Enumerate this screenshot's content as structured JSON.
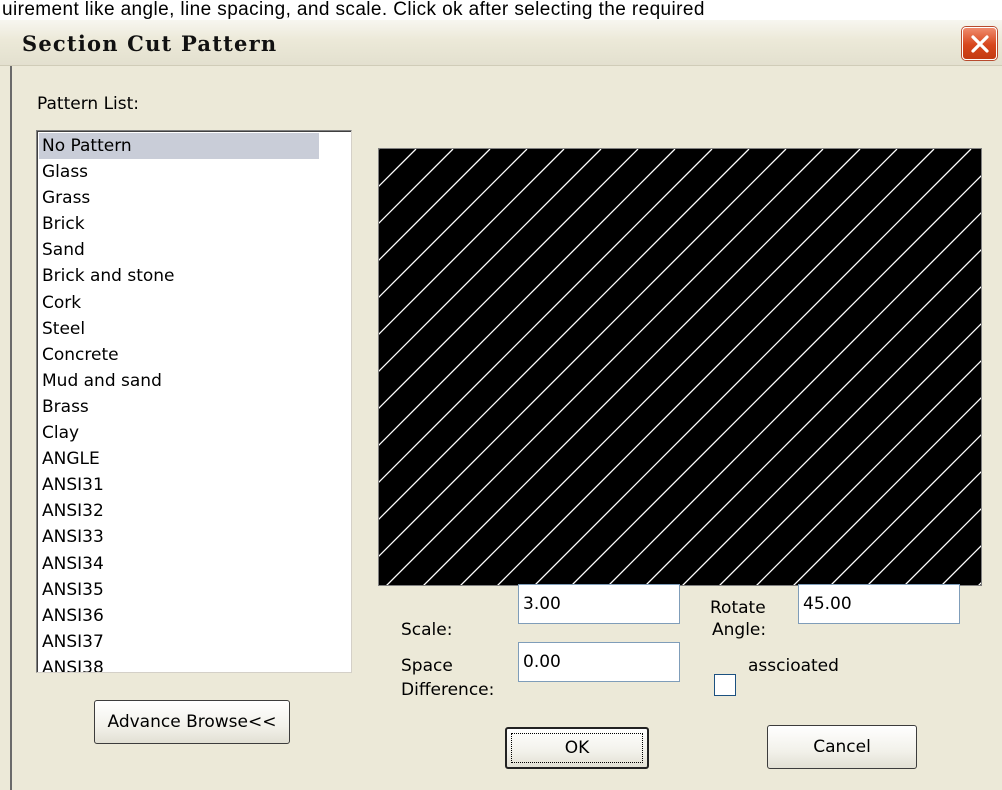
{
  "caption": "uirement like angle, line spacing, and scale. Click ok after selecting the required",
  "window": {
    "title": "Section Cut Pattern"
  },
  "pattern_list": {
    "label": "Pattern List:",
    "items": [
      "No Pattern",
      "Glass",
      "Grass",
      "Brick",
      "Sand",
      "Brick and stone",
      "Cork",
      "Steel",
      "Concrete",
      "Mud and sand",
      "Brass",
      "Clay",
      "ANGLE",
      "ANSI31",
      "ANSI32",
      "ANSI33",
      "ANSI34",
      "ANSI35",
      "ANSI36",
      "ANSI37",
      "ANSI38"
    ],
    "selected": "No Pattern"
  },
  "preview": {
    "background": "#000000",
    "line_color": "#ffffff",
    "angle_deg": 45
  },
  "fields": {
    "scale_label": "Scale:",
    "scale_value": "3.00",
    "rotate_label_1": "Rotate",
    "rotate_label_2": "Angle:",
    "rotate_value": "45.00",
    "space_label_1": "Space",
    "space_label_2": "Difference:",
    "space_value": "0.00",
    "associated_label": "asscioated",
    "associated_checked": false
  },
  "buttons": {
    "advance": "Advance Browse<<",
    "ok": "OK",
    "cancel": "Cancel"
  },
  "colors": {
    "dialog_bg": "#ece9d8",
    "close_button": "#d7461c"
  }
}
